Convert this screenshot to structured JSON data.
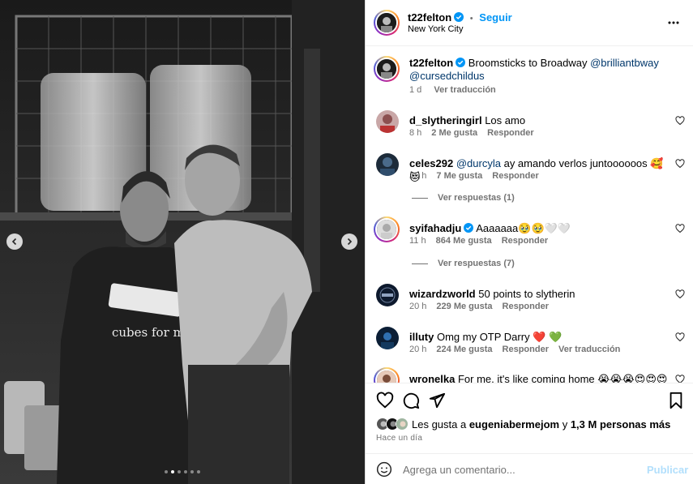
{
  "post": {
    "username": "t22felton",
    "follow_label": "Seguir",
    "separator": "•",
    "location": "New York City",
    "caption_text": "Broomsticks to Broadway",
    "caption_mention_1": "@brilliantbway",
    "caption_mention_2": "@cursedchildus",
    "caption_time": "1 d",
    "caption_translate": "Ver traducción",
    "shirt_text": "cubes for my boys"
  },
  "comments": [
    {
      "user": "d_slytheringirl",
      "text": "Los amo",
      "time": "8 h",
      "likes": "2 Me gusta",
      "reply": "Responder"
    },
    {
      "user": "celes292",
      "mention": "@durcyla",
      "text": "ay amando verlos juntoooooos 🥰😻",
      "time": "15 h",
      "likes": "7 Me gusta",
      "reply": "Responder",
      "view_replies": "Ver respuestas (1)"
    },
    {
      "user": "syifahadju",
      "text": "Aaaaaaa🥹🥹🤍🤍",
      "time": "11 h",
      "likes": "864 Me gusta",
      "reply": "Responder",
      "view_replies": "Ver respuestas (7)"
    },
    {
      "user": "wizardzworld",
      "text": "50 points to slytherin",
      "time": "20 h",
      "likes": "229 Me gusta",
      "reply": "Responder"
    },
    {
      "user": "illuty",
      "text": "Omg my OTP Darry ❤️ 💚",
      "time": "20 h",
      "likes": "224 Me gusta",
      "reply": "Responder",
      "translate": "Ver traducción"
    },
    {
      "user": "wronelka",
      "text": "For me, it's like coming home 😭😭😭😍😍😍"
    }
  ],
  "likes_bar": {
    "prefix": "Les gusta a ",
    "user": "eugeniabermejom",
    "middle": " y ",
    "count": "1,3 M personas más",
    "time_ago": "Hace un día"
  },
  "add_comment": {
    "placeholder": "Agrega un comentario...",
    "publish_label": "Publicar"
  },
  "carousel": {
    "total": 6,
    "active_index": 1
  },
  "colors": {
    "link": "#00376b",
    "accent": "#0095f6",
    "muted": "#737373",
    "verified": "#0095f6"
  }
}
